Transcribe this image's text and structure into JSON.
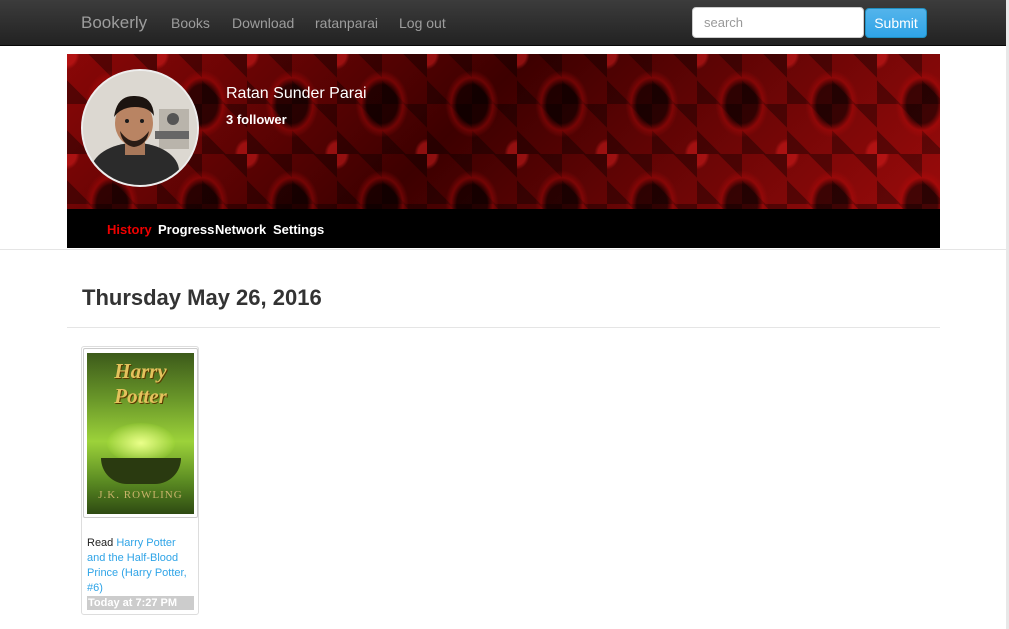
{
  "navbar": {
    "brand": "Bookerly",
    "links": [
      "Books",
      "Download",
      "ratanparai",
      "Log out"
    ],
    "search_placeholder": "search",
    "submit_label": "Submit"
  },
  "profile": {
    "name": "Ratan Sunder Parai",
    "followers": "3 follower",
    "tabs": [
      {
        "label": "History",
        "active": true
      },
      {
        "label": "Progress",
        "active": false
      },
      {
        "label": "Network",
        "active": false
      },
      {
        "label": "Settings",
        "active": false
      }
    ]
  },
  "history": {
    "date": "Thursday May 26, 2016",
    "entries": [
      {
        "action": "Read",
        "book_title": "Harry Potter and the Half-Blood Prince (Harry Potter, #6)",
        "time": "Today at 7:27 PM",
        "cover_title": "Harry Potter",
        "cover_author": "J.K. ROWLING"
      }
    ]
  },
  "colors": {
    "accent": "#2fa4e7",
    "active_tab": "#ee0000",
    "navbar_bg": "#222222"
  }
}
